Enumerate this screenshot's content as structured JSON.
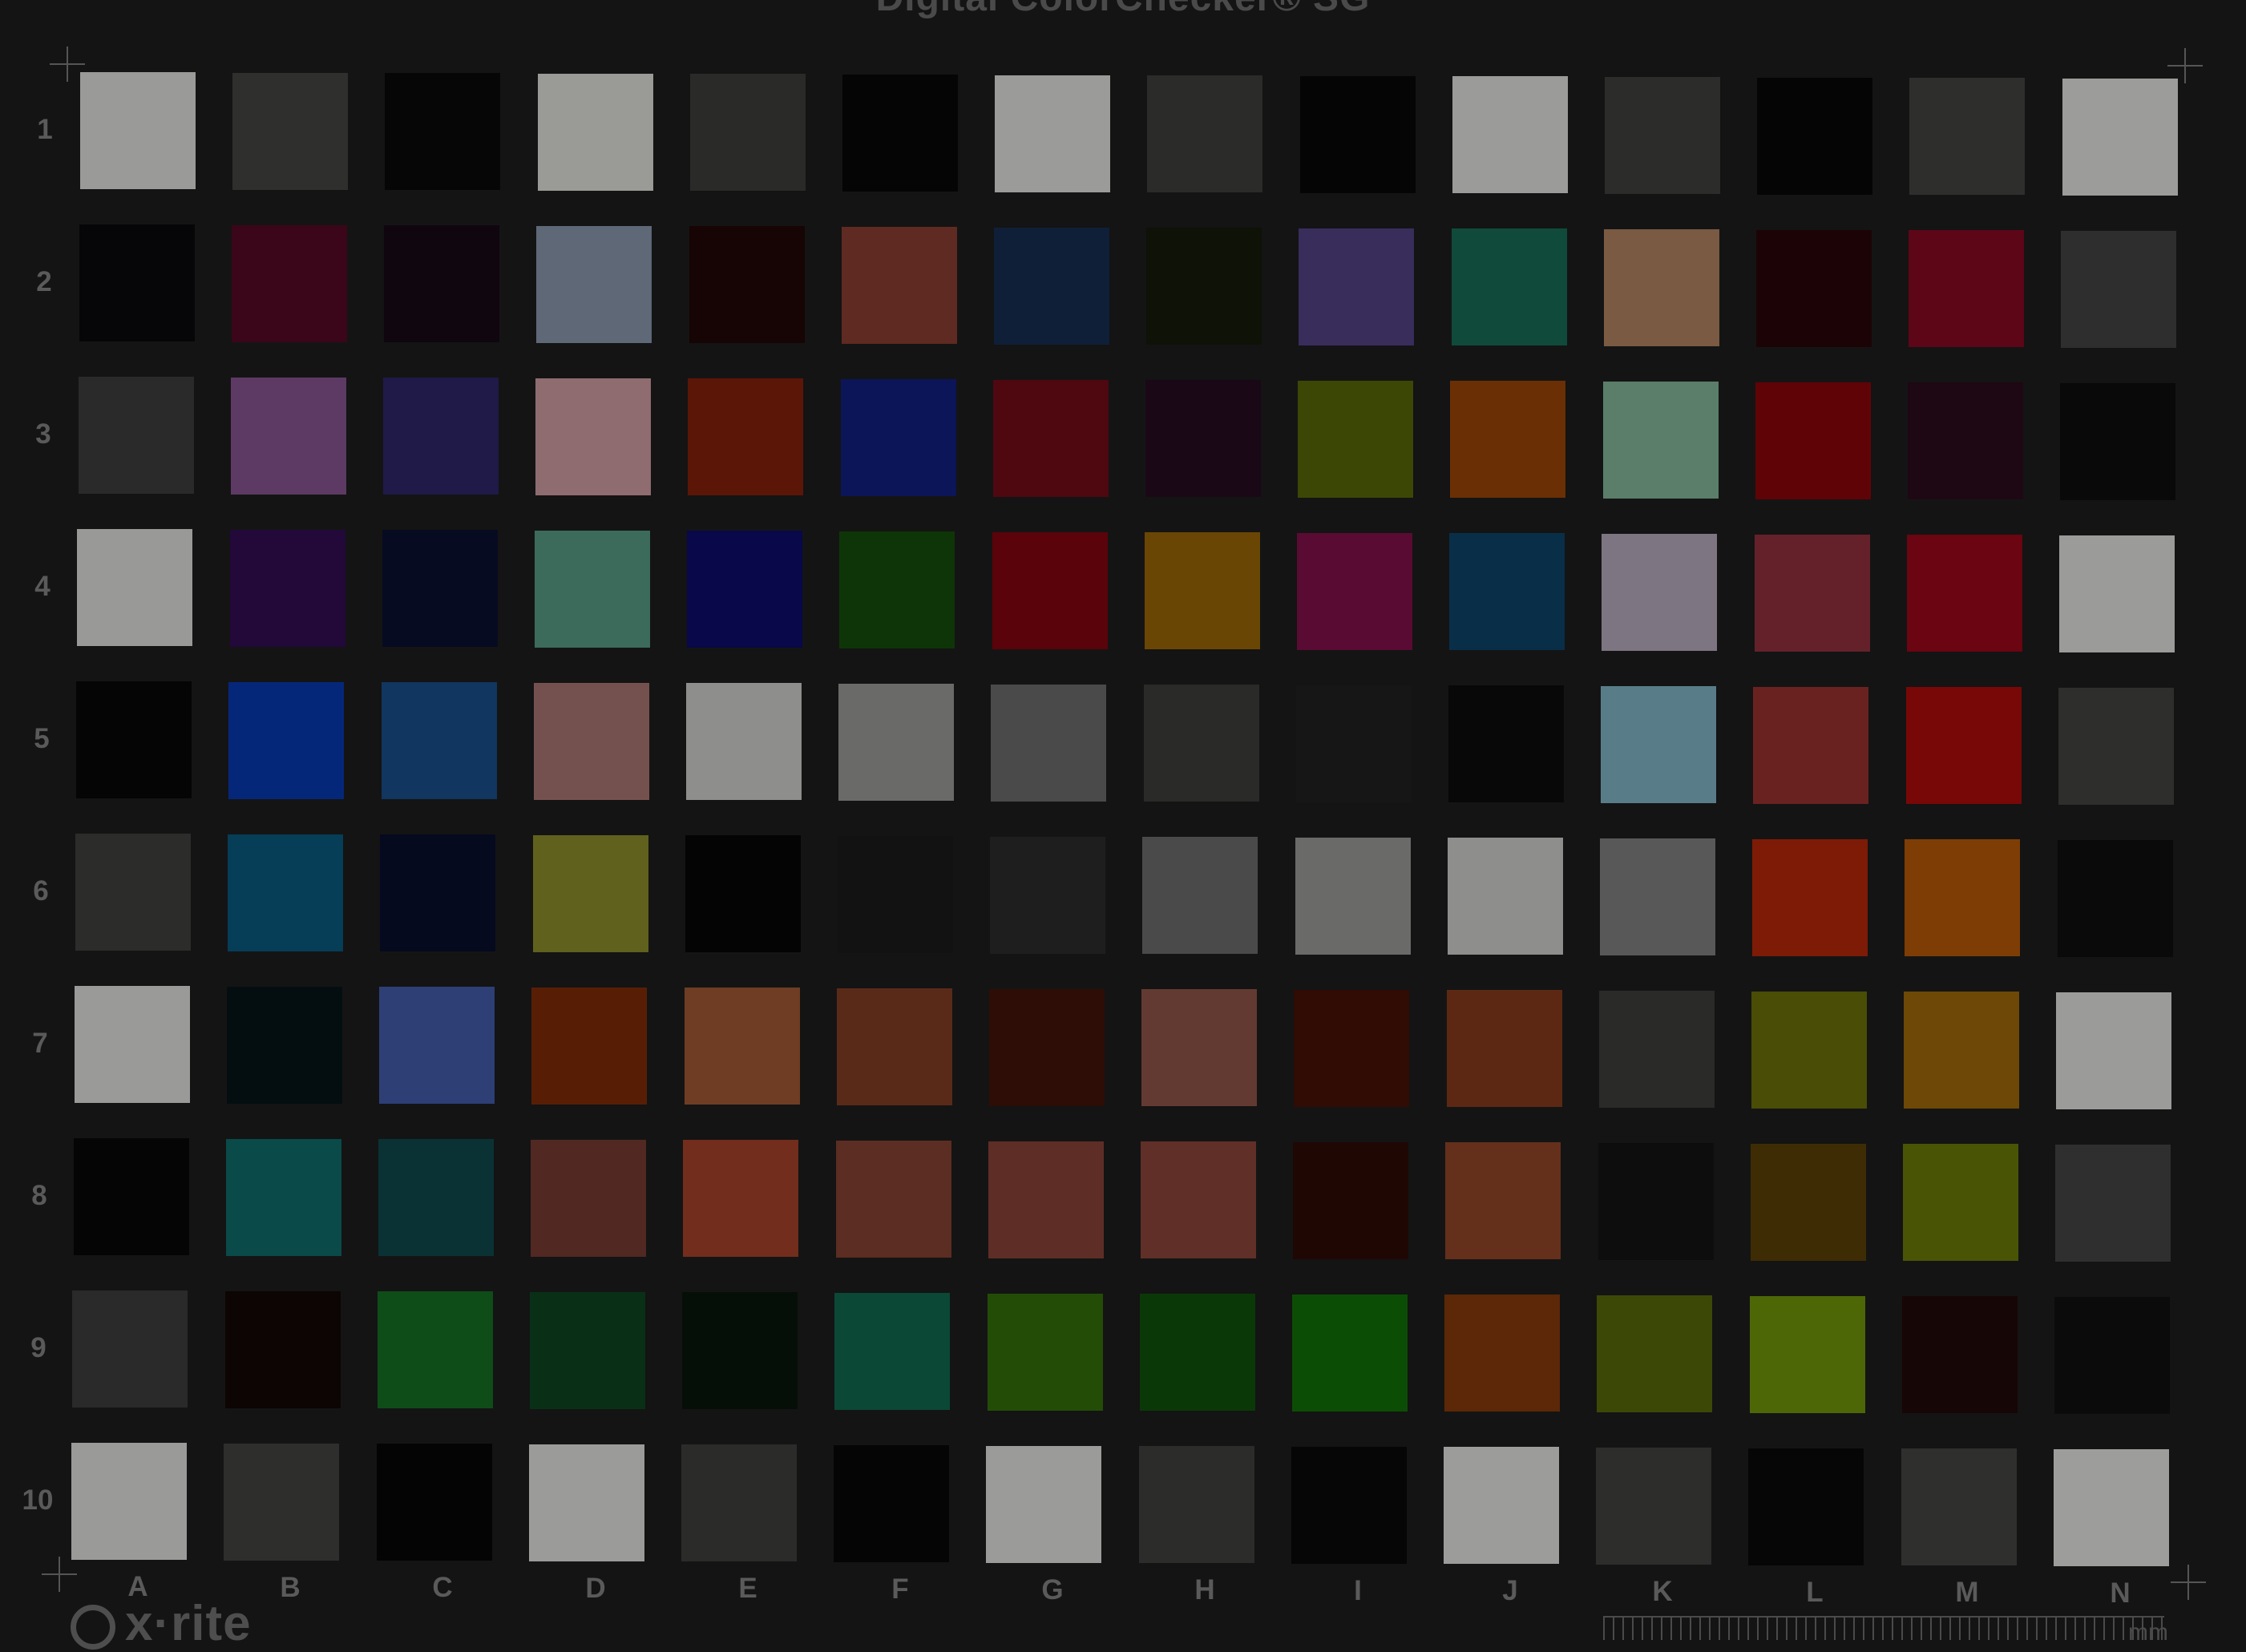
{
  "title": "Digital ColorChecker® SG",
  "brand": "x·rite",
  "ruler_unit": "mm",
  "columns": [
    "A",
    "B",
    "C",
    "D",
    "E",
    "F",
    "G",
    "H",
    "I",
    "J",
    "K",
    "L",
    "M",
    "N"
  ],
  "rows": [
    "1",
    "2",
    "3",
    "4",
    "5",
    "6",
    "7",
    "8",
    "9",
    "10"
  ],
  "patches": [
    [
      "#9a9a98",
      "#2f2f2d",
      "#060606",
      "#9a9a97",
      "#2a2a28",
      "#050505",
      "#9b9b99",
      "#2b2b29",
      "#050505",
      "#9b9b99",
      "#2c2c2a",
      "#050505",
      "#2e2e2d",
      "#9c9c9a"
    ],
    [
      "#060608",
      "#3b0619",
      "#0f0610",
      "#5e6877",
      "#170404",
      "#5e2a22",
      "#0f1f38",
      "#0e1207",
      "#392d5c",
      "#0f4a3a",
      "#7a5a43",
      "#1c0406",
      "#5c0618",
      "#2e2e2e"
    ],
    [
      "#2a2a2a",
      "#5d3a63",
      "#1f1a48",
      "#8e6c70",
      "#5b1607",
      "#0c1558",
      "#4f0710",
      "#1a0817",
      "#3c4706",
      "#6a2f05",
      "#5a7e69",
      "#600307",
      "#1e0813",
      "#090909"
    ],
    [
      "#999998",
      "#22093a",
      "#060b22",
      "#3c6a5b",
      "#08084a",
      "#0e3507",
      "#5a030a",
      "#6a4605",
      "#5a0b33",
      "#092f48",
      "#7e7582",
      "#64212a",
      "#6a0511",
      "#9b9b9a"
    ],
    [
      "#050505",
      "#05277a",
      "#11365f",
      "#74514f",
      "#8e8e8c",
      "#6a6a69",
      "#4a4a4a",
      "#2a2a28",
      "#161616",
      "#080808",
      "#587d89",
      "#6a2220",
      "#780707",
      "#2e2e2d"
    ],
    [
      "#2c2c2b",
      "#063d57",
      "#060a1e",
      "#5f611d",
      "#040404",
      "#121212",
      "#1e1e1e",
      "#4a4a4a",
      "#6a6a69",
      "#8e8e8d",
      "#585858",
      "#7d1b06",
      "#7e3d05",
      "#0a0a0a"
    ],
    [
      "#9a9a99",
      "#040e10",
      "#2e3f76",
      "#581e05",
      "#6e3d24",
      "#5a2a19",
      "#2d0d06",
      "#633a31",
      "#300c05",
      "#5c2814",
      "#2a2a29",
      "#4a4d05",
      "#6d4806",
      "#9b9b9a"
    ],
    [
      "#050505",
      "#0a4a49",
      "#0a3234",
      "#512822",
      "#722d1c",
      "#5c2d22",
      "#5e2e26",
      "#602f28",
      "#1f0804",
      "#64301c",
      "#0d0d0d",
      "#3e2c05",
      "#4a5405",
      "#2f2f2f"
    ],
    [
      "#2a2a2a",
      "#0c0504",
      "#0e4d18",
      "#093016",
      "#050f07",
      "#0b4836",
      "#234d06",
      "#0b3807",
      "#0c4d05",
      "#5c2807",
      "#3c4806",
      "#4d6707",
      "#170606",
      "#0b0b0b"
    ],
    [
      "#9a9a99",
      "#2e2e2d",
      "#040404",
      "#9b9b9a",
      "#2b2b2a",
      "#050505",
      "#9b9b9a",
      "#2c2c2b",
      "#060606",
      "#9c9c9b",
      "#2d2d2c",
      "#060606",
      "#2f2f2e",
      "#9d9d9c"
    ]
  ]
}
